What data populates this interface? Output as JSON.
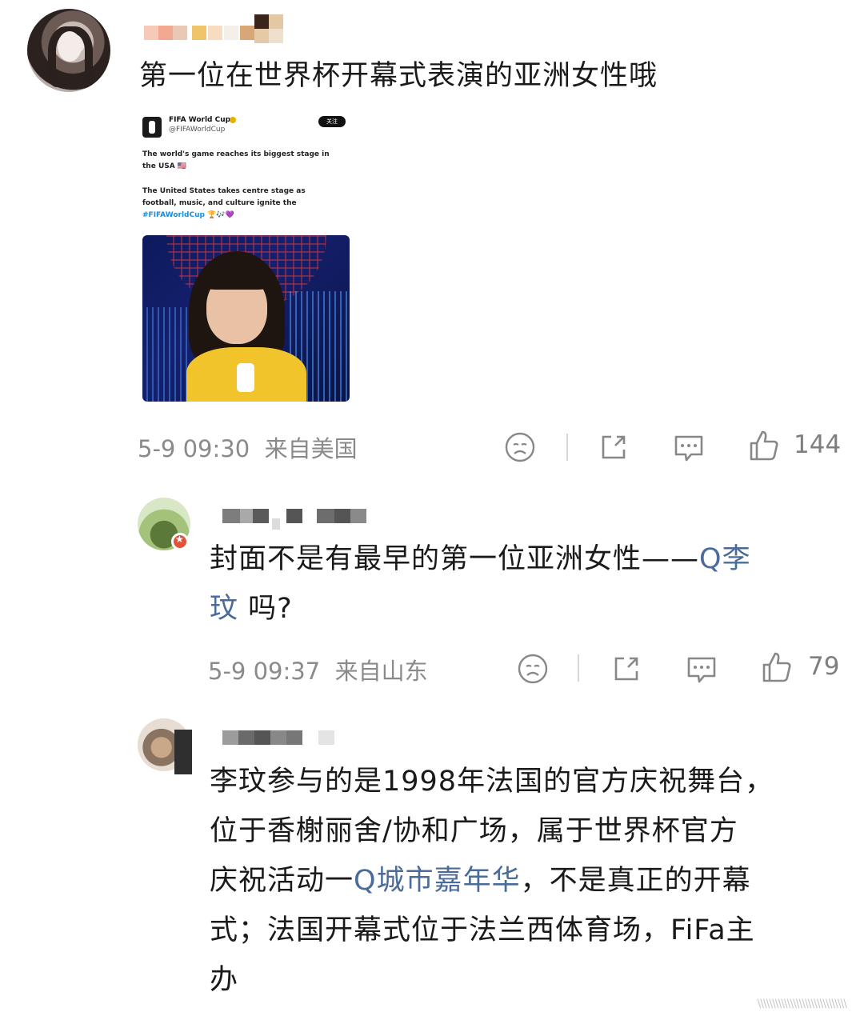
{
  "post": {
    "text": "第一位在世界杯开幕式表演的亚洲女性哦",
    "time": "5-9 09:30",
    "location": "来自美国",
    "like_count": "144"
  },
  "tweet": {
    "account_name": "FIFA World Cup",
    "account_handle": "@FIFAWorldCup",
    "follow_label": "关注",
    "line1": "The world's game reaches its biggest stage in",
    "line2": "the USA 🇺🇸",
    "line3": "The United States takes centre stage as",
    "line4": "football, music, and culture ignite the",
    "hashtag": "#FIFAWorldCup",
    "hashtag_suffix": " 🏆🎶💜"
  },
  "comments": [
    {
      "text_before": "封面不是有最早的第一位亚洲女性——",
      "link_icon": "Q",
      "link_text_1": "李",
      "link_text_2": "玟",
      "text_after": " 吗?",
      "time": "5-9 09:37",
      "location": "来自山东",
      "like_count": "79"
    },
    {
      "line1": "李玟参与的是1998年法国的官方庆祝舞台，",
      "line2": "位于香榭丽舍/协和广场，属于世界杯官方",
      "line3_before": "庆祝活动一",
      "link_icon": "Q",
      "link_text": "城市嘉年华",
      "line3_after": "，不是真正的开幕",
      "line4": "式；法国开幕式位于法兰西体育场，FiFa主",
      "line5": "办"
    }
  ],
  "icons": [
    "sad-face-icon",
    "share-icon",
    "comment-icon",
    "thumbs-up-icon",
    "search-link-icon"
  ],
  "colors": {
    "link": "#4b6c9a",
    "meta": "#8a8a8a",
    "hashtag": "#1d8bd6"
  }
}
